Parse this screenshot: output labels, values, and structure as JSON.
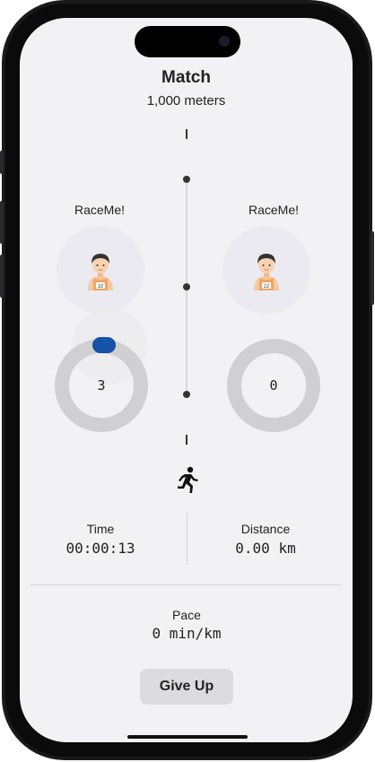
{
  "header": {
    "title": "Match",
    "subtitle": "1,000 meters"
  },
  "racers": [
    {
      "name": "RaceMe!",
      "progress_value": "3",
      "progress_fraction": 0.03
    },
    {
      "name": "RaceMe!",
      "progress_value": "0",
      "progress_fraction": 0.0
    }
  ],
  "stats": {
    "time_label": "Time",
    "time_value": "00:00:13",
    "distance_label": "Distance",
    "distance_value": "0.00 km",
    "pace_label": "Pace",
    "pace_value": "0 min/km"
  },
  "actions": {
    "give_up_label": "Give Up"
  },
  "colors": {
    "background": "#f2f2f4",
    "progress_accent": "#1552a8",
    "ring_track": "#d0d0d3",
    "button_bg": "#dcdcdf"
  },
  "icons": {
    "avatar": "runner-avatar-icon",
    "activity": "running-person-icon"
  }
}
